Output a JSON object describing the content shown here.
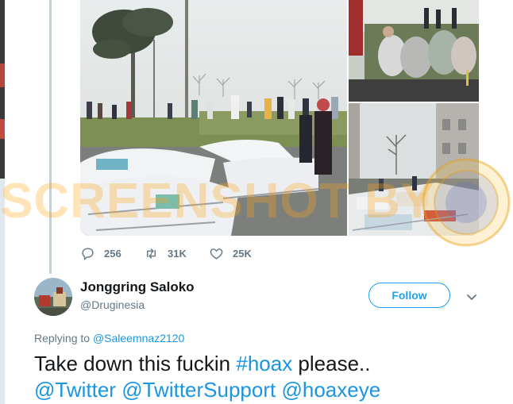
{
  "thread_tweet": {
    "stats": {
      "replies": "256",
      "retweets": "31K",
      "likes": "25K"
    },
    "media": [
      {
        "icon": "photo-hospital-beds-outdoors"
      },
      {
        "icon": "photo-patients-with-blankets"
      },
      {
        "icon": "photo-beds-beside-building"
      }
    ]
  },
  "watermark": {
    "text": "SCREENSHOT BY",
    "seal": "TURN BACK HOAX MAFINDO"
  },
  "reply_tweet": {
    "author_name": "Jonggring Saloko",
    "author_handle": "@Druginesia",
    "follow_label": "Follow",
    "replying_prefix": "Replying to",
    "replying_to": "@Saleemnaz2120",
    "text_part1": "Take down this fuckin ",
    "hashtag": "#hoax",
    "text_part2": " please..",
    "mentions": [
      "@Twitter",
      "@TwitterSupport",
      "@hoaxeye"
    ]
  },
  "colors": {
    "link_blue": "#1b95e0",
    "follow_blue": "#1da1f2",
    "muted_gray": "#657786",
    "text_dark": "#14171a"
  }
}
